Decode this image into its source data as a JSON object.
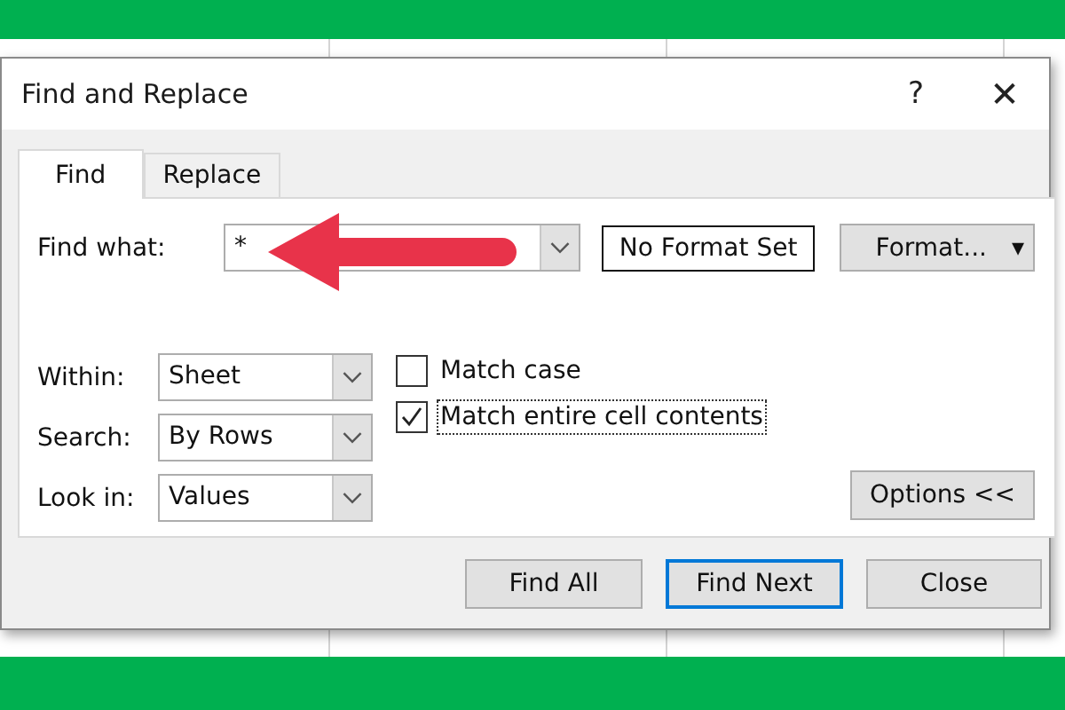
{
  "window": {
    "title": "Find and Replace",
    "help": "?",
    "close": "✕"
  },
  "tabs": [
    {
      "label": "Find",
      "selected": true
    },
    {
      "label": "Replace",
      "selected": false
    }
  ],
  "find_what": {
    "label": "Find what:",
    "value": "*"
  },
  "format_status": "No Format Set",
  "format_button": {
    "label": "Format...",
    "caret": "▾"
  },
  "options": [
    {
      "label": "Within:",
      "value": "Sheet"
    },
    {
      "label": "Search:",
      "value": "By Rows"
    },
    {
      "label": "Look in:",
      "value": "Values"
    }
  ],
  "checkboxes": [
    {
      "label": "Match case",
      "checked": false,
      "focused": false
    },
    {
      "label": "Match entire cell contents",
      "checked": true,
      "focused": true
    }
  ],
  "options_button": "Options <<",
  "buttons": [
    {
      "label": "Find All",
      "default": false
    },
    {
      "label": "Find Next",
      "default": true
    },
    {
      "label": "Close",
      "default": false
    }
  ]
}
